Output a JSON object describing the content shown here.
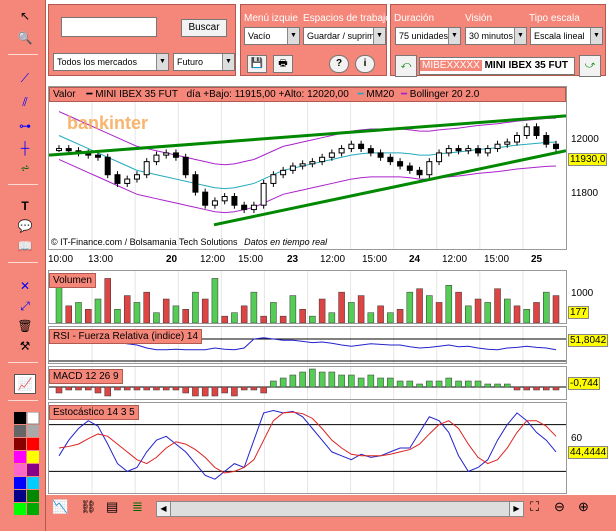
{
  "search": {
    "value": "",
    "button": "Buscar"
  },
  "markets": {
    "selected": "Todos los mercados",
    "type": "Futuro"
  },
  "menus": {
    "menu_label": "Menú izquie",
    "menu_value": "Vacío",
    "spaces_label": "Espacios de trabajo",
    "spaces_value": "Guardar / suprimir",
    "duration_label": "Duración",
    "duration_value": "75 unidades",
    "vision_label": "Visión",
    "vision_value": "30 minutos",
    "scale_label": "Tipo escala",
    "scale_value": "Escala lineal"
  },
  "ticker": {
    "code": "MIBEXXXXX",
    "name": "MINI IBEX 35 FUT"
  },
  "main_chart": {
    "valor_label": "Valor",
    "series_name": "MINI IBEX 35 FUT",
    "day_info": "día +Bajo: 11915,00 +Alto: 12020,00",
    "mm_label": "MM20",
    "boll_label": "Bollinger 20 2.0",
    "logo": "bankinter",
    "credit": "© IT-Finance.com / Bolsamania Tech Solutions",
    "realtime": "Datos en tiempo real",
    "price_box": "11930,0",
    "y_ticks": [
      "12000",
      "11800"
    ]
  },
  "x_axis": [
    "10:00",
    "13:00",
    "20",
    "12:00",
    "15:00",
    "23",
    "12:00",
    "15:00",
    "24",
    "12:00",
    "15:00",
    "25"
  ],
  "volume": {
    "label": "Volumen",
    "tick": "1000",
    "value": "177"
  },
  "rsi": {
    "label": "RSI - Fuerza Relativa (indice) 14",
    "value": "51,8042"
  },
  "macd": {
    "label": "MACD 12 26 9",
    "value": "-0,744"
  },
  "stoch": {
    "label": "Estocástico 14 3 5",
    "tick": "60",
    "value": "44,4444"
  },
  "chart_data": [
    {
      "type": "line",
      "title": "MINI IBEX 35 FUT",
      "series": [
        {
          "name": "MINI IBEX 35 FUT",
          "values": [
            11960,
            11955,
            11950,
            11945,
            11940,
            11900,
            11880,
            11890,
            11900,
            11930,
            11945,
            11950,
            11940,
            11900,
            11860,
            11830,
            11840,
            11850,
            11830,
            11820,
            11830,
            11880,
            11900,
            11910,
            11920,
            11925,
            11930,
            11940,
            11950,
            11960,
            11970,
            11960,
            11950,
            11940,
            11930,
            11920,
            11910,
            11900,
            11930,
            11950,
            11960,
            11955,
            11960,
            11950,
            11960,
            11970,
            11975,
            11990,
            12010,
            11990,
            11970,
            11960
          ]
        },
        {
          "name": "MM20",
          "values": [
            11990,
            11980,
            11970,
            11960,
            11950,
            11940,
            11930,
            11920,
            11910,
            11905,
            11900,
            11895,
            11890,
            11885,
            11880,
            11875,
            11870,
            11868,
            11870,
            11875,
            11880,
            11890,
            11900,
            11910,
            11915,
            11920,
            11925,
            11930,
            11935,
            11940,
            11945,
            11948,
            11950,
            11950,
            11950,
            11950,
            11948,
            11945,
            11945,
            11948,
            11950,
            11952,
            11955,
            11958,
            11960,
            11962,
            11965,
            11968,
            11970,
            11972,
            11974,
            11975
          ]
        }
      ],
      "y_ticks": [
        12000,
        11800
      ]
    },
    {
      "type": "bar",
      "title": "Volumen",
      "values": [
        1200,
        500,
        600,
        400,
        700,
        1300,
        400,
        800,
        600,
        900,
        300,
        700,
        500,
        400,
        900,
        700,
        1300,
        200,
        300,
        500,
        900,
        200,
        600,
        200,
        800,
        400,
        200,
        700,
        300,
        900,
        600,
        800,
        300,
        500,
        300,
        400,
        900,
        1000,
        800,
        600,
        1100,
        900,
        500,
        700,
        600,
        1000,
        700,
        500,
        400,
        600,
        900,
        800
      ]
    },
    {
      "type": "line",
      "title": "RSI - Fuerza Relativa (indice) 14",
      "values": [
        70,
        68,
        66,
        67,
        65,
        63,
        64,
        62,
        60,
        55,
        52,
        52,
        53,
        52,
        52,
        52,
        55,
        53,
        52,
        55,
        70,
        72,
        70,
        68,
        68,
        66,
        64,
        65,
        63,
        60,
        58,
        60,
        62,
        61,
        60,
        60,
        57,
        55,
        56,
        58,
        60,
        57,
        58,
        55,
        53,
        52,
        55,
        56,
        58,
        56,
        55,
        52
      ]
    },
    {
      "type": "bar",
      "title": "MACD 12 26 9",
      "values": [
        -2,
        -1,
        -1,
        -1,
        -2,
        -3,
        -1,
        -1,
        -1,
        -1,
        -1,
        -1,
        -1,
        -2,
        -3,
        -3,
        -3,
        -2,
        -3,
        -1,
        -1,
        -2,
        2,
        3,
        4,
        5,
        6,
        5,
        5,
        4,
        4,
        3,
        4,
        3,
        3,
        2,
        2,
        1,
        2,
        2,
        3,
        2,
        2,
        2,
        1,
        1,
        1,
        -1,
        -1,
        -1,
        -1,
        -1
      ]
    },
    {
      "type": "line",
      "title": "Estocástico 14 3 5",
      "series": [
        {
          "name": "%K",
          "values": [
            40,
            60,
            75,
            85,
            78,
            55,
            30,
            20,
            25,
            45,
            60,
            65,
            55,
            45,
            30,
            15,
            10,
            20,
            30,
            25,
            60,
            95,
            98,
            95,
            97,
            90,
            75,
            60,
            45,
            40,
            35,
            42,
            38,
            40,
            45,
            50,
            50,
            70,
            90,
            85,
            70,
            40,
            20,
            25,
            35,
            60,
            80,
            95,
            85,
            70,
            60,
            45
          ]
        },
        {
          "name": "%D",
          "values": [
            50,
            52,
            55,
            62,
            68,
            65,
            55,
            45,
            35,
            30,
            38,
            50,
            58,
            55,
            48,
            38,
            25,
            18,
            20,
            25,
            35,
            60,
            85,
            95,
            96,
            94,
            88,
            75,
            60,
            50,
            42,
            40,
            40,
            40,
            42,
            45,
            48,
            55,
            68,
            80,
            85,
            75,
            55,
            38,
            30,
            35,
            50,
            70,
            85,
            85,
            78,
            65
          ]
        }
      ],
      "y_ticks": [
        60
      ]
    }
  ]
}
